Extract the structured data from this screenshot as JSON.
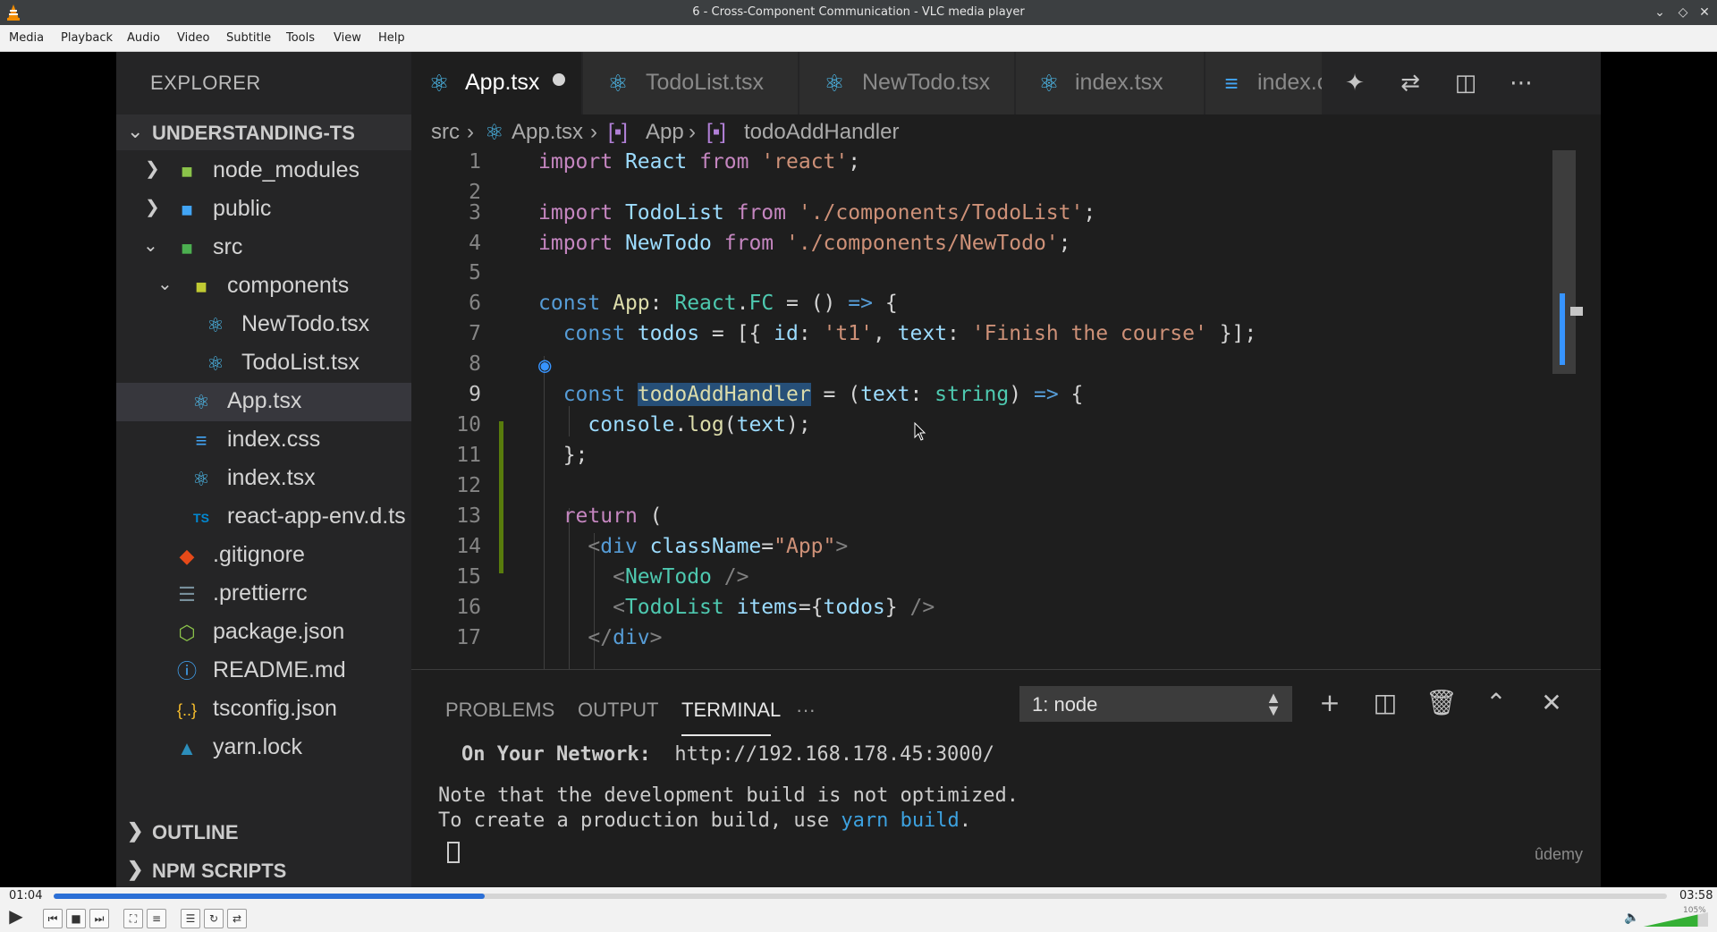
{
  "window": {
    "title": "6 - Cross-Component Communication - VLC media player"
  },
  "menu": [
    "Media",
    "Playback",
    "Audio",
    "Video",
    "Subtitle",
    "Tools",
    "View",
    "Help"
  ],
  "sidebar": {
    "title": "EXPLORER",
    "root": "UNDERSTANDING-TS",
    "items": [
      {
        "label": "node_modules",
        "icon": "folder-node-icon",
        "color": "#8bc34a"
      },
      {
        "label": "public",
        "icon": "folder-public-icon",
        "color": "#42a5f5"
      },
      {
        "label": "src",
        "icon": "folder-src-icon",
        "color": "#4caf50"
      },
      {
        "label": "components",
        "icon": "folder-components-icon",
        "color": "#c0ca33"
      },
      {
        "label": "NewTodo.tsx",
        "icon": "react-icon",
        "color": "#4fc3f7"
      },
      {
        "label": "TodoList.tsx",
        "icon": "react-icon",
        "color": "#4fc3f7"
      },
      {
        "label": "App.tsx",
        "icon": "react-icon",
        "color": "#4fc3f7"
      },
      {
        "label": "index.css",
        "icon": "css-icon",
        "color": "#42a5f5"
      },
      {
        "label": "index.tsx",
        "icon": "react-icon",
        "color": "#4fc3f7"
      },
      {
        "label": "react-app-env.d.ts",
        "icon": "typescript-icon",
        "color": "#0288d1"
      },
      {
        "label": ".gitignore",
        "icon": "git-icon",
        "color": "#e64a19"
      },
      {
        "label": ".prettierrc",
        "icon": "prettier-icon",
        "color": "#78909c"
      },
      {
        "label": "package.json",
        "icon": "nodejs-icon",
        "color": "#8bc34a"
      },
      {
        "label": "README.md",
        "icon": "info-icon",
        "color": "#42a5f5"
      },
      {
        "label": "tsconfig.json",
        "icon": "json-icon",
        "color": "#fbc02d"
      },
      {
        "label": "yarn.lock",
        "icon": "yarn-icon",
        "color": "#2c8ebb"
      }
    ],
    "sections": [
      "OUTLINE",
      "NPM SCRIPTS"
    ]
  },
  "tabs": [
    "App.tsx",
    "TodoList.tsx",
    "NewTodo.tsx",
    "index.tsx",
    "index.cs"
  ],
  "breadcrumb": [
    "src",
    "App.tsx",
    "App",
    "todoAddHandler"
  ],
  "line_numbers": [
    "1",
    "2",
    "3",
    "4",
    "5",
    "6",
    "7",
    "8",
    "9",
    "10",
    "11",
    "12",
    "13",
    "14",
    "15",
    "16",
    "17"
  ],
  "panel": {
    "tabs": [
      "PROBLEMS",
      "OUTPUT",
      "TERMINAL",
      "···"
    ],
    "terminal_select": "1: node",
    "network_label": "On Your Network:",
    "network_url": "http://192.168.178.45:3000/",
    "note1": "Note that the development build is not optimized.",
    "note2_prefix": "To create a production build, use ",
    "note2_cmd": "yarn build",
    "note2_suffix": "."
  },
  "watermark": "ûdemy",
  "player": {
    "elapsed": "01:04",
    "total": "03:58",
    "progress": 0.267,
    "volume_label": "105%",
    "volume": 1.05,
    "accent": "#2b6fd6"
  }
}
